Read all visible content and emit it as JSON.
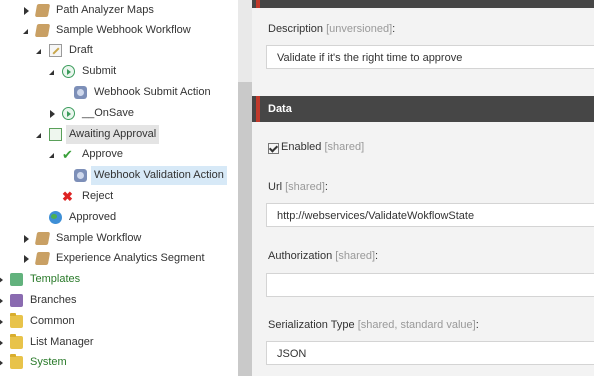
{
  "tree": {
    "items": [
      {
        "label": "Path Analyzer Maps",
        "icon": "workflow-icon"
      },
      {
        "label": "Sample Webhook Workflow",
        "icon": "workflow-icon"
      },
      {
        "label": "Draft",
        "icon": "draft-state-icon"
      },
      {
        "label": "Submit",
        "icon": "command-icon"
      },
      {
        "label": "Webhook Submit Action",
        "icon": "action-icon"
      },
      {
        "label": "__OnSave",
        "icon": "command-icon"
      },
      {
        "label": "Awaiting Approval",
        "icon": "state-icon"
      },
      {
        "label": "Approve",
        "icon": "check-icon"
      },
      {
        "label": "Webhook Validation Action",
        "icon": "action-icon"
      },
      {
        "label": "Reject",
        "icon": "reject-icon"
      },
      {
        "label": "Approved",
        "icon": "globe-icon"
      },
      {
        "label": "Sample Workflow",
        "icon": "workflow-icon"
      },
      {
        "label": "Experience Analytics Segment",
        "icon": "workflow-icon"
      },
      {
        "label": "Templates",
        "icon": "templates-icon"
      },
      {
        "label": "Branches",
        "icon": "branches-icon"
      },
      {
        "label": "Common",
        "icon": "folder-icon"
      },
      {
        "label": "List Manager",
        "icon": "folder-icon"
      },
      {
        "label": "System",
        "icon": "folder-icon"
      }
    ]
  },
  "content": {
    "description": {
      "label": "Description",
      "meta": "[unversioned]",
      "colon": ":",
      "value": "Validate if it's the right time to approve"
    },
    "data_section": {
      "title": "Data"
    },
    "enabled": {
      "label": "Enabled",
      "meta": "[shared]",
      "checked": true
    },
    "url": {
      "label": "Url",
      "meta": "[shared]",
      "colon": ":",
      "value": "http://webservices/ValidateWokflowState"
    },
    "authorization": {
      "label": "Authorization",
      "meta": "[shared]",
      "colon": ":",
      "value": ""
    },
    "serialization": {
      "label": "Serialization Type",
      "meta": "[shared, standard value]",
      "colon": ":",
      "value": "JSON"
    }
  },
  "colors": {
    "section_header": "#464646",
    "accent": "#c0392b",
    "selected": "#d7e9f7"
  }
}
